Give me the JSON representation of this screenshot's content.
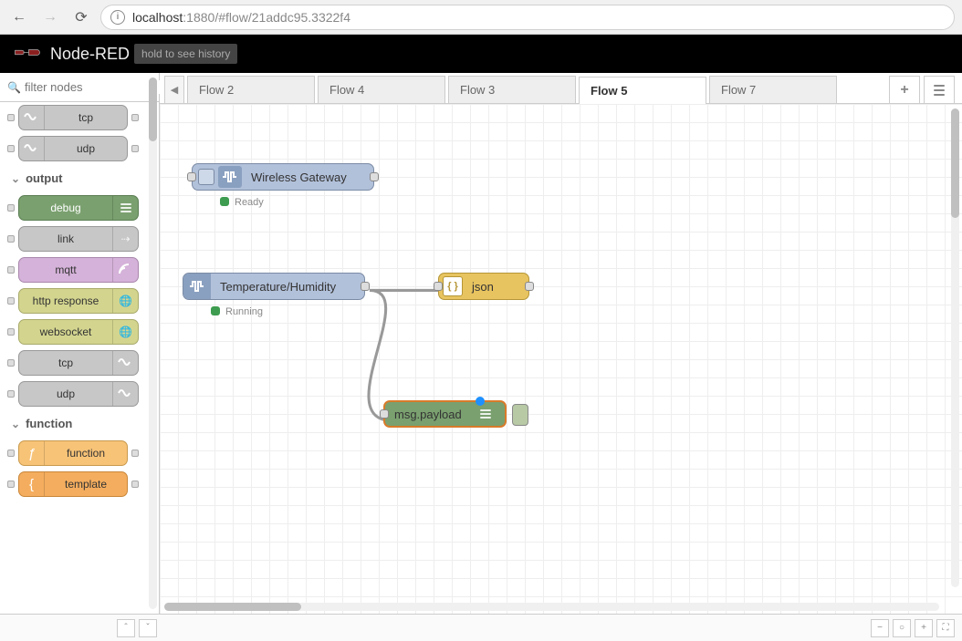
{
  "browser": {
    "url_info": "ⓘ",
    "url_host": "localhost",
    "url_port": ":1880",
    "url_path": "/#flow/21addc95.3322f4"
  },
  "header": {
    "title": "Node-RED",
    "hint": "hold to see history"
  },
  "palette": {
    "filter_placeholder": "filter nodes",
    "input_nodes": {
      "tcp": "tcp",
      "udp": "udp"
    },
    "cat_output": "output",
    "output_nodes": {
      "debug": "debug",
      "link": "link",
      "mqtt": "mqtt",
      "http_response": "http response",
      "websocket": "websocket",
      "tcp": "tcp",
      "udp": "udp"
    },
    "cat_function": "function",
    "function_nodes": {
      "function": "function",
      "template": "template"
    }
  },
  "tabs": {
    "t1": "Flow 2",
    "t2": "Flow 4",
    "t3": "Flow 3",
    "t4": "Flow 5",
    "t5": "Flow 7"
  },
  "flow": {
    "gateway": {
      "label": "Wireless Gateway",
      "status": "Ready"
    },
    "temp": {
      "label": "Temperature/Humidity",
      "status": "Running"
    },
    "json": {
      "label": "json"
    },
    "debug": {
      "label": "msg.payload"
    }
  },
  "colors": {
    "blue": "#b2c1da",
    "green": "#7aa06f",
    "yellow": "#e8c460",
    "gray": "#c7c7c7",
    "purple": "#d5b2d9",
    "olive": "#d3d58f",
    "orange": "#f7c377",
    "lorange": "#f4ad5e"
  }
}
